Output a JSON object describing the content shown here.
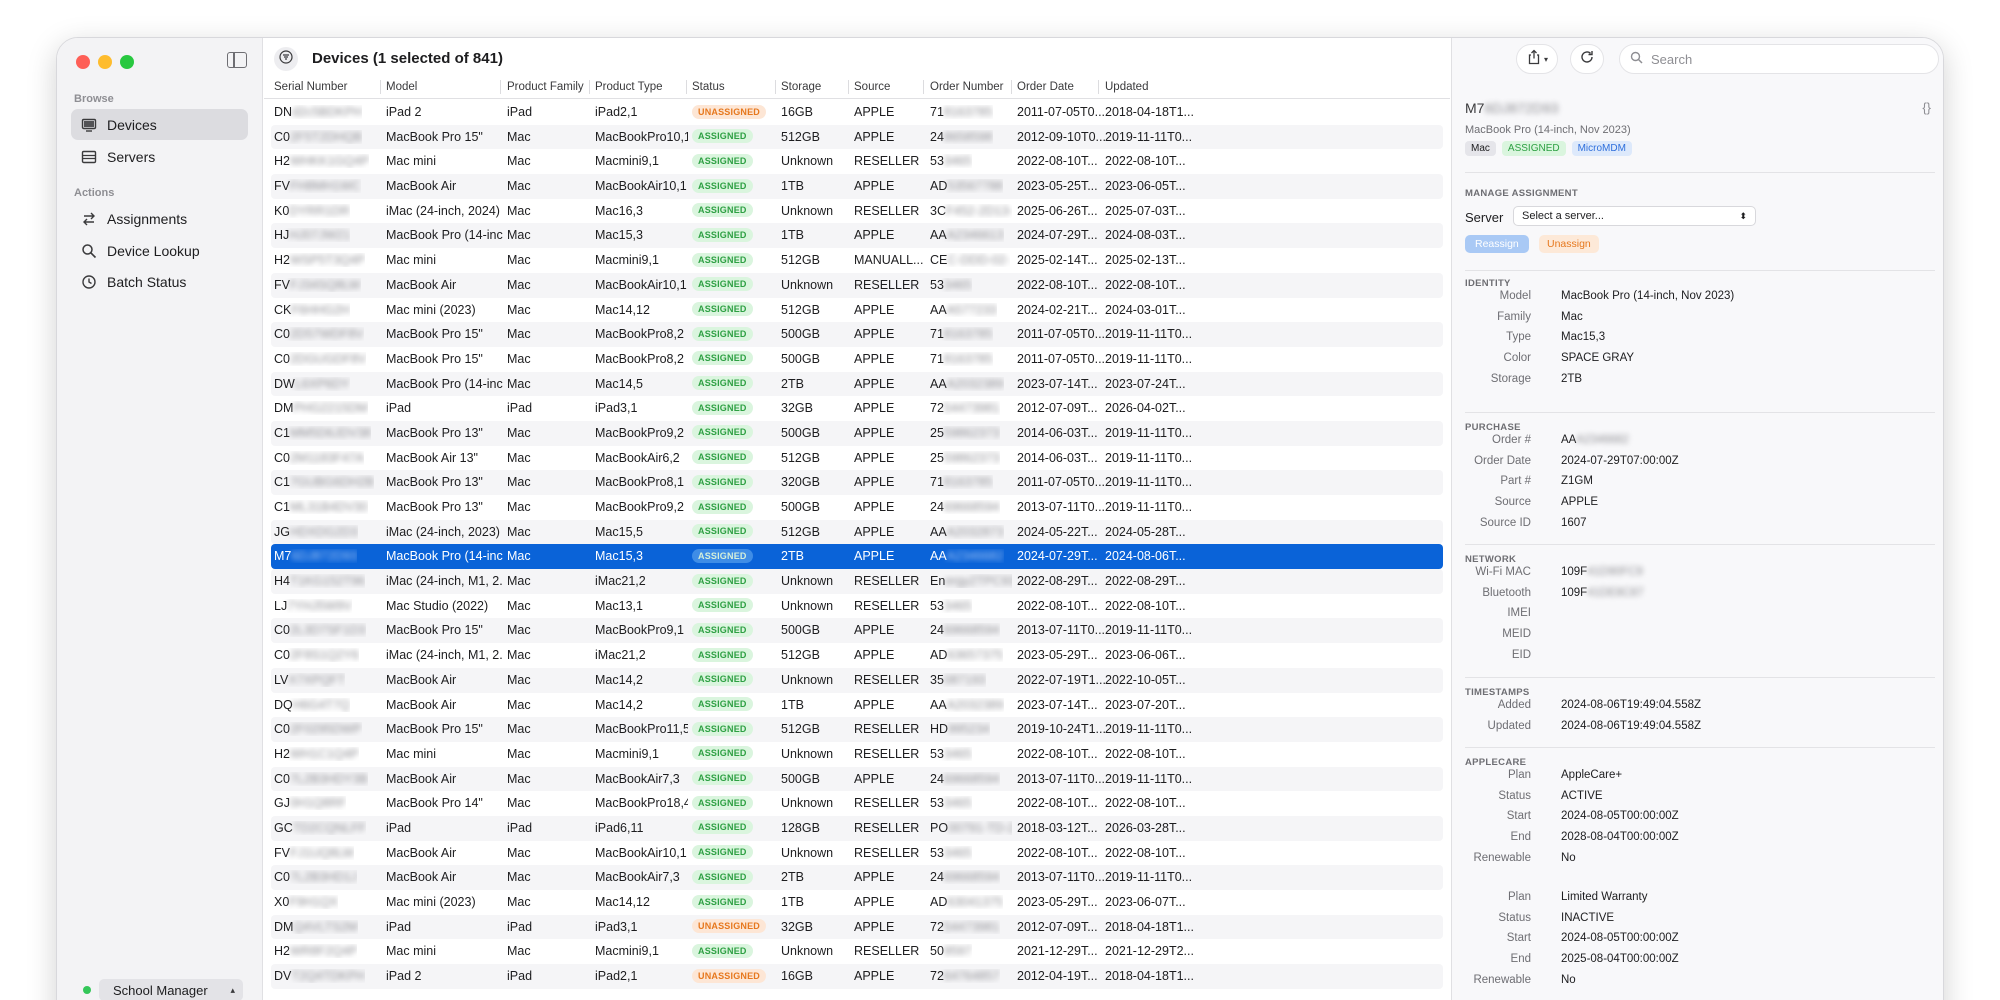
{
  "sidebar": {
    "browse_label": "Browse",
    "actions_label": "Actions",
    "items": [
      {
        "label": "Devices",
        "icon": "display-icon"
      },
      {
        "label": "Servers",
        "icon": "server-icon"
      },
      {
        "label": "Assignments",
        "icon": "arrows-icon"
      },
      {
        "label": "Device Lookup",
        "icon": "magnifier-icon"
      },
      {
        "label": "Batch Status",
        "icon": "clock-icon"
      }
    ],
    "footer_server": "School Manager"
  },
  "main": {
    "title": "Devices (1 selected of 841)",
    "columns": [
      "Serial Number",
      "Model",
      "Product Family",
      "Product Type",
      "Status",
      "Storage",
      "Source",
      "Order Number",
      "Order Date",
      "Updated"
    ],
    "rows": [
      {
        "serial_prefix": "DN",
        "serial_rest": "d2c5BDKPH",
        "model": "iPad 2",
        "family": "iPad",
        "type": "iPad2,1",
        "status": "UNASSIGNED",
        "storage": "16GB",
        "source": "APPLE",
        "order_prefix": "71",
        "order_rest": "8163785",
        "order_date": "2011-07-05T0...",
        "updated": "2018-04-18T1..."
      },
      {
        "serial_prefix": "C0",
        "serial_rest": "2F5T2DHQB",
        "model": "MacBook Pro 15\"",
        "family": "Mac",
        "type": "MacBookPro10,1",
        "status": "ASSIGNED",
        "storage": "512GB",
        "source": "APPLE",
        "order_prefix": "24",
        "order_rest": "8658598",
        "order_date": "2012-09-10T0...",
        "updated": "2019-11-11T0..."
      },
      {
        "serial_prefix": "H2",
        "serial_rest": "WHKK1GQ4P",
        "model": "Mac mini",
        "family": "Mac",
        "type": "Macmini9,1",
        "status": "ASSIGNED",
        "storage": "Unknown",
        "source": "RESELLER",
        "order_prefix": "53",
        "order_rest": "3465",
        "order_date": "2022-08-10T...",
        "updated": "2022-08-10T..."
      },
      {
        "serial_prefix": "FV",
        "serial_rest": "FH8MH1WC",
        "model": "MacBook Air",
        "family": "Mac",
        "type": "MacBookAir10,1",
        "status": "ASSIGNED",
        "storage": "1TB",
        "source": "APPLE",
        "order_prefix": "AD",
        "order_rest": "53567788",
        "order_date": "2023-05-25T...",
        "updated": "2023-06-05T..."
      },
      {
        "serial_prefix": "K0",
        "serial_rest": "DYRR1DR",
        "model": "iMac (24-inch, 2024)",
        "family": "Mac",
        "type": "Mac16,3",
        "status": "ASSIGNED",
        "storage": "Unknown",
        "source": "RESELLER",
        "order_prefix": "3C",
        "order_rest": "F452-2D13-",
        "order_date": "2025-06-26T...",
        "updated": "2025-07-03T..."
      },
      {
        "serial_prefix": "HJ",
        "serial_rest": "HJ07JW21",
        "model": "MacBook Pro (14-inc...",
        "family": "Mac",
        "type": "Mac15,3",
        "status": "ASSIGNED",
        "storage": "1TB",
        "source": "APPLE",
        "order_prefix": "AA",
        "order_rest": "A2346613",
        "order_date": "2024-07-29T...",
        "updated": "2024-08-03T..."
      },
      {
        "serial_prefix": "H2",
        "serial_rest": "WSP5T3Q4P",
        "model": "Mac mini",
        "family": "Mac",
        "type": "Macmini9,1",
        "status": "ASSIGNED",
        "storage": "512GB",
        "source": "MANUALL...",
        "order_prefix": "CE",
        "order_rest": "C-DDD-02-",
        "order_date": "2025-02-14T...",
        "updated": "2025-02-13T..."
      },
      {
        "serial_prefix": "FV",
        "serial_rest": "FJ34SQ8LW",
        "model": "MacBook Air",
        "family": "Mac",
        "type": "MacBookAir10,1",
        "status": "ASSIGNED",
        "storage": "Unknown",
        "source": "RESELLER",
        "order_prefix": "53",
        "order_rest": "3465",
        "order_date": "2022-08-10T...",
        "updated": "2022-08-10T..."
      },
      {
        "serial_prefix": "CK",
        "serial_rest": "F6HHG2H",
        "model": "Mac mini (2023)",
        "family": "Mac",
        "type": "Mac14,12",
        "status": "ASSIGNED",
        "storage": "512GB",
        "source": "APPLE",
        "order_prefix": "AA",
        "order_rest": "A577233",
        "order_date": "2024-02-21T...",
        "updated": "2024-03-01T..."
      },
      {
        "serial_prefix": "C0",
        "serial_rest": "2D57WDF8V",
        "model": "MacBook Pro 15\"",
        "family": "Mac",
        "type": "MacBookPro8,2",
        "status": "ASSIGNED",
        "storage": "500GB",
        "source": "APPLE",
        "order_prefix": "71",
        "order_rest": "8163785",
        "order_date": "2011-07-05T0...",
        "updated": "2019-11-11T0..."
      },
      {
        "serial_prefix": "C0",
        "serial_rest": "2DGUGDF8V",
        "model": "MacBook Pro 15\"",
        "family": "Mac",
        "type": "MacBookPro8,2",
        "status": "ASSIGNED",
        "storage": "500GB",
        "source": "APPLE",
        "order_prefix": "71",
        "order_rest": "8163785",
        "order_date": "2011-07-05T0...",
        "updated": "2019-11-11T0..."
      },
      {
        "serial_prefix": "DW",
        "serial_rest": "L6XP6DY",
        "model": "MacBook Pro (14-inc...",
        "family": "Mac",
        "type": "Mac14,5",
        "status": "ASSIGNED",
        "storage": "2TB",
        "source": "APPLE",
        "order_prefix": "AA",
        "order_rest": "A2032389",
        "order_date": "2023-07-14T...",
        "updated": "2023-07-24T..."
      },
      {
        "serial_prefix": "DM",
        "serial_rest": "PHG2215DM",
        "model": "iPad",
        "family": "iPad",
        "type": "iPad3,1",
        "status": "ASSIGNED",
        "storage": "32GB",
        "source": "APPLE",
        "order_prefix": "72",
        "order_rest": "54473981",
        "order_date": "2012-07-09T...",
        "updated": "2026-04-02T..."
      },
      {
        "serial_prefix": "C1",
        "serial_rest": "MM5D6JDV38",
        "model": "MacBook Pro 13\"",
        "family": "Mac",
        "type": "MacBookPro9,2",
        "status": "ASSIGNED",
        "storage": "500GB",
        "source": "APPLE",
        "order_prefix": "25",
        "order_rest": "59862373",
        "order_date": "2014-06-03T...",
        "updated": "2019-11-11T0..."
      },
      {
        "serial_prefix": "C0",
        "serial_rest": "2M1183F47A",
        "model": "MacBook Air 13\"",
        "family": "Mac",
        "type": "MacBookAir6,2",
        "status": "ASSIGNED",
        "storage": "512GB",
        "source": "APPLE",
        "order_prefix": "25",
        "order_rest": "59862373",
        "order_date": "2014-06-03T...",
        "updated": "2019-11-11T0..."
      },
      {
        "serial_prefix": "C1",
        "serial_rest": "7GUBG6DH2B",
        "model": "MacBook Pro 13\"",
        "family": "Mac",
        "type": "MacBookPro8,1",
        "status": "ASSIGNED",
        "storage": "320GB",
        "source": "APPLE",
        "order_prefix": "71",
        "order_rest": "8163785",
        "order_date": "2011-07-05T0...",
        "updated": "2019-11-11T0..."
      },
      {
        "serial_prefix": "C1",
        "serial_rest": "ML31B4DV30",
        "model": "MacBook Pro 13\"",
        "family": "Mac",
        "type": "MacBookPro9,2",
        "status": "ASSIGNED",
        "storage": "500GB",
        "source": "APPLE",
        "order_prefix": "24",
        "order_rest": "69668594",
        "order_date": "2013-07-11T0...",
        "updated": "2019-11-11T0..."
      },
      {
        "serial_prefix": "JG",
        "serial_rest": "HDXDG2D3",
        "model": "iMac (24-inch, 2023)",
        "family": "Mac",
        "type": "Mac15,5",
        "status": "ASSIGNED",
        "storage": "512GB",
        "source": "APPLE",
        "order_prefix": "AA",
        "order_rest": "A2032873",
        "order_date": "2024-05-22T...",
        "updated": "2024-05-28T..."
      },
      {
        "serial_prefix": "M7",
        "serial_rest": "6DJ872D93",
        "model": "MacBook Pro (14-inc...",
        "family": "Mac",
        "type": "Mac15,3",
        "status": "ASSIGNED",
        "storage": "2TB",
        "source": "APPLE",
        "order_prefix": "AA",
        "order_rest": "A2346682",
        "order_date": "2024-07-29T...",
        "updated": "2024-08-06T...",
        "selected": true
      },
      {
        "serial_prefix": "H4",
        "serial_rest": "T1KG152T96",
        "model": "iMac (24-inch, M1, 2...",
        "family": "Mac",
        "type": "iMac21,2",
        "status": "ASSIGNED",
        "storage": "Unknown",
        "source": "RESELLER",
        "order_prefix": "En",
        "order_rest": "ergy2TPC93",
        "order_date": "2022-08-29T...",
        "updated": "2022-08-29T..."
      },
      {
        "serial_prefix": "LJ",
        "serial_rest": "7YHJ5W9V",
        "model": "Mac Studio (2022)",
        "family": "Mac",
        "type": "Mac13,1",
        "status": "ASSIGNED",
        "storage": "Unknown",
        "source": "RESELLER",
        "order_prefix": "53",
        "order_rest": "3465",
        "order_date": "2022-08-10T...",
        "updated": "2022-08-10T..."
      },
      {
        "serial_prefix": "C0",
        "serial_rest": "2L3D7SF1D3",
        "model": "MacBook Pro 15\"",
        "family": "Mac",
        "type": "MacBookPro9,1",
        "status": "ASSIGNED",
        "storage": "500GB",
        "source": "APPLE",
        "order_prefix": "24",
        "order_rest": "69668594",
        "order_date": "2013-07-11T0...",
        "updated": "2019-11-11T0..."
      },
      {
        "serial_prefix": "C0",
        "serial_rest": "2F8S1Q2Y6",
        "model": "iMac (24-inch, M1, 2...",
        "family": "Mac",
        "type": "iMac21,2",
        "status": "ASSIGNED",
        "storage": "512GB",
        "source": "APPLE",
        "order_prefix": "AD",
        "order_rest": "63657375",
        "order_date": "2023-05-29T...",
        "updated": "2023-06-06T..."
      },
      {
        "serial_prefix": "LV",
        "serial_rest": "X7XPQFT",
        "model": "MacBook Air",
        "family": "Mac",
        "type": "Mac14,2",
        "status": "ASSIGNED",
        "storage": "Unknown",
        "source": "RESELLER",
        "order_prefix": "35",
        "order_rest": "087193",
        "order_date": "2022-07-19T1...",
        "updated": "2022-10-05T..."
      },
      {
        "serial_prefix": "DQ",
        "serial_rest": "H6G4T7Q",
        "model": "MacBook Air",
        "family": "Mac",
        "type": "Mac14,2",
        "status": "ASSIGNED",
        "storage": "1TB",
        "source": "APPLE",
        "order_prefix": "AA",
        "order_rest": "A2032389",
        "order_date": "2023-07-14T...",
        "updated": "2023-07-20T..."
      },
      {
        "serial_prefix": "C0",
        "serial_rest": "2F0295DWP",
        "model": "MacBook Pro 15\"",
        "family": "Mac",
        "type": "MacBookPro11,5",
        "status": "ASSIGNED",
        "storage": "512GB",
        "source": "RESELLER",
        "order_prefix": "HD",
        "order_rest": "995234",
        "order_date": "2019-10-24T1...",
        "updated": "2019-11-11T0..."
      },
      {
        "serial_prefix": "H2",
        "serial_rest": "WH1C1Q4P",
        "model": "Mac mini",
        "family": "Mac",
        "type": "Macmini9,1",
        "status": "ASSIGNED",
        "storage": "Unknown",
        "source": "RESELLER",
        "order_prefix": "53",
        "order_rest": "3465",
        "order_date": "2022-08-10T...",
        "updated": "2022-08-10T..."
      },
      {
        "serial_prefix": "C0",
        "serial_rest": "7L2B3HDY3B",
        "model": "MacBook Air",
        "family": "Mac",
        "type": "MacBookAir7,3",
        "status": "ASSIGNED",
        "storage": "500GB",
        "source": "APPLE",
        "order_prefix": "24",
        "order_rest": "69668594",
        "order_date": "2013-07-11T0...",
        "updated": "2019-11-11T0..."
      },
      {
        "serial_prefix": "GJ",
        "serial_rest": "0H1Q8RF",
        "model": "MacBook Pro 14\"",
        "family": "Mac",
        "type": "MacBookPro18,4",
        "status": "ASSIGNED",
        "storage": "Unknown",
        "source": "RESELLER",
        "order_prefix": "53",
        "order_rest": "3465",
        "order_date": "2022-08-10T...",
        "updated": "2022-08-10T..."
      },
      {
        "serial_prefix": "GC",
        "serial_rest": "TD2CQNLFF",
        "model": "iPad",
        "family": "iPad",
        "type": "iPad6,11",
        "status": "ASSIGNED",
        "storage": "128GB",
        "source": "RESELLER",
        "order_prefix": "PO",
        "order_rest": "00791-TD-2",
        "order_date": "2018-03-12T...",
        "updated": "2026-03-28T..."
      },
      {
        "serial_prefix": "FV",
        "serial_rest": "FJ1UQ8LW",
        "model": "MacBook Air",
        "family": "Mac",
        "type": "MacBookAir10,1",
        "status": "ASSIGNED",
        "storage": "Unknown",
        "source": "RESELLER",
        "order_prefix": "53",
        "order_rest": "3465",
        "order_date": "2022-08-10T...",
        "updated": "2022-08-10T..."
      },
      {
        "serial_prefix": "C0",
        "serial_rest": "7L2B3HD1J",
        "model": "MacBook Air",
        "family": "Mac",
        "type": "MacBookAir7,3",
        "status": "ASSIGNED",
        "storage": "2TB",
        "source": "APPLE",
        "order_prefix": "24",
        "order_rest": "69668594",
        "order_date": "2013-07-11T0...",
        "updated": "2019-11-11T0..."
      },
      {
        "serial_prefix": "X0",
        "serial_rest": "F9H1QX",
        "model": "Mac mini (2023)",
        "family": "Mac",
        "type": "Mac14,12",
        "status": "ASSIGNED",
        "storage": "1TB",
        "source": "APPLE",
        "order_prefix": "AD",
        "order_rest": "63041375",
        "order_date": "2023-05-29T...",
        "updated": "2023-06-07T..."
      },
      {
        "serial_prefix": "DM",
        "serial_rest": "Q4VLTS2M",
        "model": "iPad",
        "family": "iPad",
        "type": "iPad3,1",
        "status": "UNASSIGNED",
        "storage": "32GB",
        "source": "APPLE",
        "order_prefix": "72",
        "order_rest": "54473981",
        "order_date": "2012-07-09T...",
        "updated": "2018-04-18T1..."
      },
      {
        "serial_prefix": "H2",
        "serial_rest": "WR8F2Q4P",
        "model": "Mac mini",
        "family": "Mac",
        "type": "Macmini9,1",
        "status": "ASSIGNED",
        "storage": "Unknown",
        "source": "RESELLER",
        "order_prefix": "50",
        "order_rest": "9597",
        "order_date": "2021-12-29T...",
        "updated": "2021-12-29T2..."
      },
      {
        "serial_prefix": "DV",
        "serial_rest": "T2Q4TDKPH",
        "model": "iPad 2",
        "family": "iPad",
        "type": "iPad2,1",
        "status": "UNASSIGNED",
        "storage": "16GB",
        "source": "APPLE",
        "order_prefix": "72",
        "order_rest": "64764857",
        "order_date": "2012-04-19T...",
        "updated": "2018-04-18T1..."
      }
    ]
  },
  "detail": {
    "search_placeholder": "Search",
    "title_prefix": "M7",
    "title_rest": "6DJ872D93",
    "subtitle": "MacBook Pro (14-inch, Nov 2023)",
    "json_glyph": "{}",
    "tags": [
      "Mac",
      "ASSIGNED",
      "MicroMDM"
    ],
    "manage_title": "MANAGE ASSIGNMENT",
    "server_label": "Server",
    "server_placeholder": "Select a server...",
    "reassign": "Reassign",
    "unassign": "Unassign",
    "identity_title": "IDENTITY",
    "identity": [
      {
        "k": "Model",
        "v": "MacBook Pro (14-inch, Nov 2023)"
      },
      {
        "k": "Family",
        "v": "Mac"
      },
      {
        "k": "Type",
        "v": "Mac15,3"
      },
      {
        "k": "Color",
        "v": "SPACE GRAY"
      },
      {
        "k": "Storage",
        "v": "2TB"
      }
    ],
    "purchase_title": "PURCHASE",
    "purchase": [
      {
        "k": "Order #",
        "v": "AA",
        "blur": "A2346682"
      },
      {
        "k": "Order Date",
        "v": "2024-07-29T07:00:00Z"
      },
      {
        "k": "Part #",
        "v": "Z1GM"
      },
      {
        "k": "Source",
        "v": "APPLE"
      },
      {
        "k": "Source ID",
        "v": "1607"
      }
    ],
    "network_title": "NETWORK",
    "network": [
      {
        "k": "Wi-Fi MAC",
        "v": "109F",
        "blur": "41D90FC9"
      },
      {
        "k": "Bluetooth",
        "v": "109F",
        "blur": "41DE8C87"
      },
      {
        "k": "IMEI",
        "v": ""
      },
      {
        "k": "MEID",
        "v": ""
      },
      {
        "k": "EID",
        "v": ""
      }
    ],
    "timestamps_title": "TIMESTAMPS",
    "timestamps": [
      {
        "k": "Added",
        "v": "2024-08-06T19:49:04.558Z"
      },
      {
        "k": "Updated",
        "v": "2024-08-06T19:49:04.558Z"
      }
    ],
    "applecare_title": "APPLECARE",
    "applecare": [
      {
        "k": "Plan",
        "v": "AppleCare+"
      },
      {
        "k": "Status",
        "v": "ACTIVE"
      },
      {
        "k": "Start",
        "v": "2024-08-05T00:00:00Z"
      },
      {
        "k": "End",
        "v": "2028-08-04T00:00:00Z"
      },
      {
        "k": "Renewable",
        "v": "No"
      }
    ],
    "warranty": [
      {
        "k": "Plan",
        "v": "Limited Warranty"
      },
      {
        "k": "Status",
        "v": "INACTIVE"
      },
      {
        "k": "Start",
        "v": "2024-08-05T00:00:00Z"
      },
      {
        "k": "End",
        "v": "2025-08-04T00:00:00Z"
      },
      {
        "k": "Renewable",
        "v": "No"
      }
    ]
  }
}
